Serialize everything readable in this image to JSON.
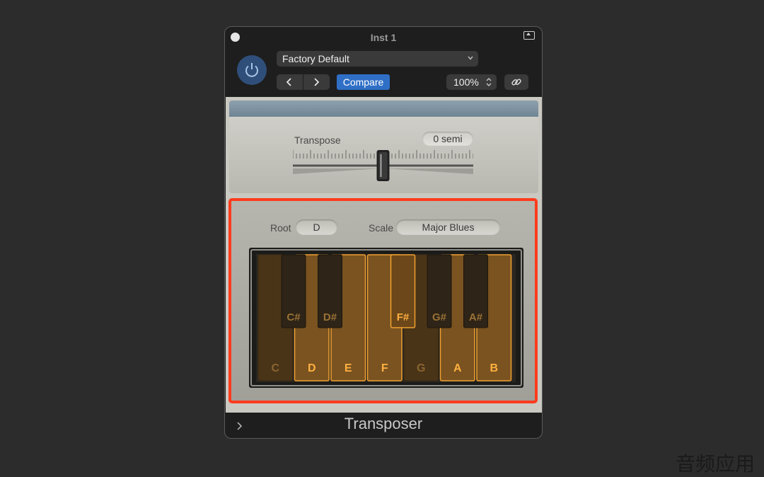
{
  "window": {
    "title": "Inst 1",
    "plugin_name": "Transposer"
  },
  "header": {
    "preset": "Factory Default",
    "compare_label": "Compare",
    "zoom": "100%"
  },
  "transpose": {
    "label": "Transpose",
    "value": "0 semi",
    "slider_level": 0.5
  },
  "scale": {
    "root_label": "Root",
    "root_value": "D",
    "scale_label": "Scale",
    "scale_value": "Major Blues"
  },
  "keyboard": {
    "white_keys": [
      {
        "note": "C",
        "active": false
      },
      {
        "note": "D",
        "active": true
      },
      {
        "note": "E",
        "active": true
      },
      {
        "note": "F",
        "active": true
      },
      {
        "note": "G",
        "active": false
      },
      {
        "note": "A",
        "active": true
      },
      {
        "note": "B",
        "active": true
      }
    ],
    "black_keys": [
      {
        "note": "C#",
        "active": false
      },
      {
        "note": "D#",
        "active": false
      },
      {
        "note": "F#",
        "active": true
      },
      {
        "note": "G#",
        "active": false
      },
      {
        "note": "A#",
        "active": false
      }
    ]
  },
  "watermark": "音频应用",
  "colors": {
    "accent_blue": "#2f6fc6",
    "highlight_border": "#ff3b1c",
    "active_key_outline": "#f0a030",
    "active_key_label": "#ffb040"
  }
}
